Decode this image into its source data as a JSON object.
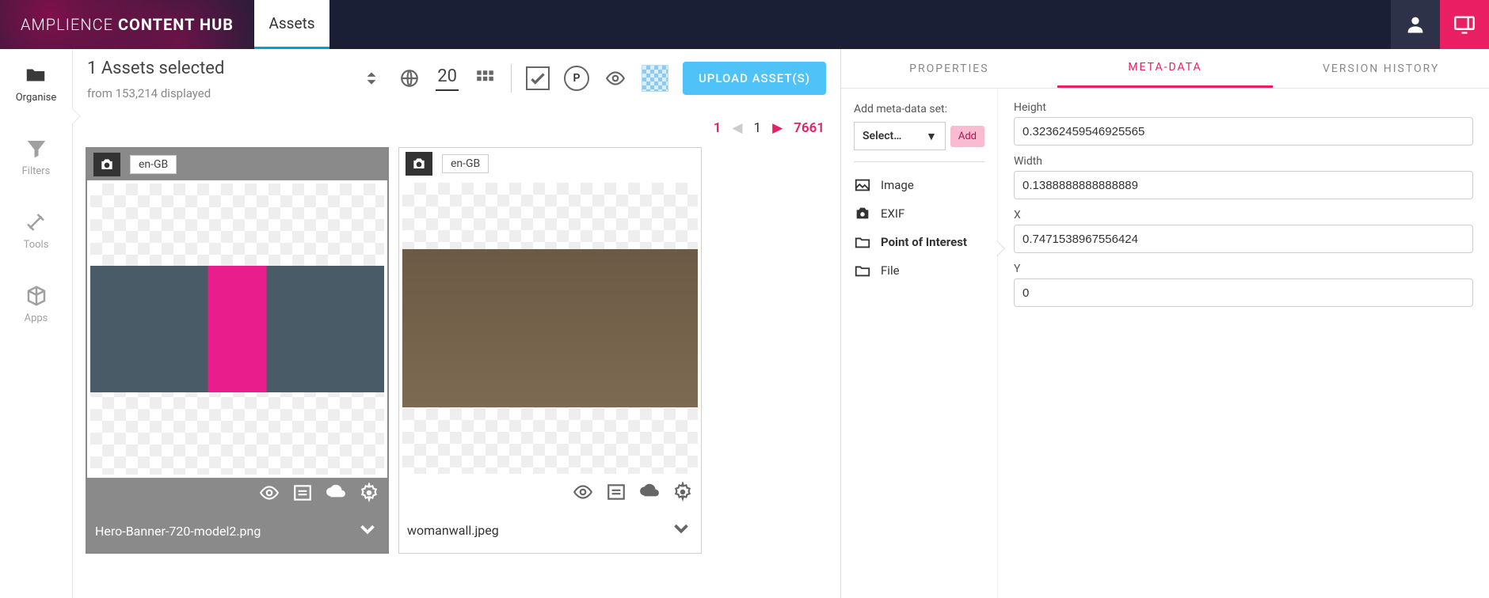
{
  "header": {
    "brand_light": "AMPLIENCE",
    "brand_bold": "CONTENT HUB",
    "tab_assets": "Assets"
  },
  "rail": {
    "organise": "Organise",
    "filters": "Filters",
    "tools": "Tools",
    "apps": "Apps"
  },
  "toolbar": {
    "selected_text": "1 Assets selected",
    "from_text": "from 153,214 displayed",
    "page_size": "20",
    "publish_letter": "P",
    "upload_label": "UPLOAD ASSET(S)"
  },
  "pager": {
    "current": "1",
    "page": "1",
    "total": "7661"
  },
  "cards": [
    {
      "locale": "en-GB",
      "filename": "Hero-Banner-720-model2.png",
      "selected": true
    },
    {
      "locale": "en-GB",
      "filename": "womanwall.jpeg",
      "selected": false
    }
  ],
  "inspector": {
    "tabs": {
      "properties": "PROPERTIES",
      "metadata": "META-DATA",
      "version": "VERSION HISTORY"
    },
    "meta_nav": {
      "add_label": "Add meta-data set:",
      "select_placeholder": "Select…",
      "add_btn": "Add",
      "items": {
        "image": "Image",
        "exif": "EXIF",
        "poi": "Point of Interest",
        "file": "File"
      }
    },
    "fields": {
      "height": {
        "label": "Height",
        "value": "0.32362459546925565"
      },
      "width": {
        "label": "Width",
        "value": "0.1388888888888889"
      },
      "x": {
        "label": "X",
        "value": "0.7471538967556424"
      },
      "y": {
        "label": "Y",
        "value": "0"
      }
    }
  }
}
